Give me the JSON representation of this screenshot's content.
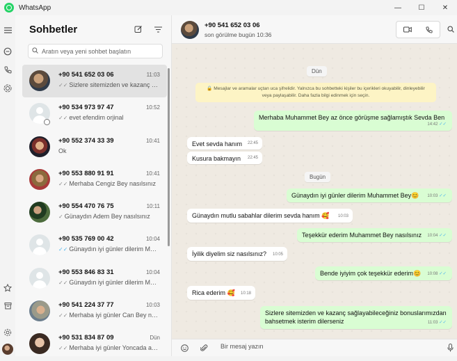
{
  "window": {
    "title": "WhatsApp",
    "controls": {
      "minimize": "—",
      "maximize": "☐",
      "close": "✕"
    }
  },
  "rail": {
    "icons": [
      "menu-icon",
      "chats-icon",
      "calls-icon",
      "status-icon",
      "starred-icon",
      "archive-icon",
      "settings-icon",
      "profile-avatar"
    ]
  },
  "sidebar": {
    "title": "Sohbetler",
    "new_chat_icon": "new-chat-icon",
    "filter_icon": "filter-icon",
    "search_placeholder": "Aratın veya yeni sohbet başlatın"
  },
  "chats": [
    {
      "name": "+90 541 652 03 06",
      "time": "11:03",
      "tick": "✓✓",
      "preview": "Sizlere sitemizden ve kazanç sağlayabileceğiniz bonuslarımızdan",
      "selected": true
    },
    {
      "name": "+90 534 973 97 47",
      "time": "10:52",
      "tick": "✓✓",
      "preview": "evet efendim orjinal"
    },
    {
      "name": "+90 552 374 33 39",
      "time": "10:41",
      "tick": "",
      "preview": "Ok"
    },
    {
      "name": "+90 553 880 91 91",
      "time": "10:41",
      "tick": "✓✓",
      "preview": "Merhaba Cengiz Bey nasılsınız"
    },
    {
      "name": "+90 554 470 76 75",
      "time": "10:11",
      "tick": "✓",
      "preview": "Günaydın Adem Bey nasılsınız"
    },
    {
      "name": "+90 535 769 00 42",
      "time": "10:04",
      "tick": "✓✓",
      "preview": "Günaydın iyi günler dilerim Muhammet Bey"
    },
    {
      "name": "+90 553 846 83 31",
      "time": "10:04",
      "tick": "✓✓",
      "preview": "Günaydın iyi günler dilerim Muhammet Bey"
    },
    {
      "name": "+90 541 224 37 77",
      "time": "10:03",
      "tick": "✓✓",
      "preview": "Merhaba iyi günler Can Bey nasılsınız"
    },
    {
      "name": "+90 531 834 87 09",
      "time": "Dün",
      "tick": "✓✓",
      "preview": "Merhaba iyi günler Yoncada ablam"
    }
  ],
  "conversation": {
    "name": "+90 541 652 03 06",
    "status": "son görülme bugün 10:36",
    "day_yesterday": "Dün",
    "day_today": "Bugün",
    "encryption_notice": "🔒 Mesajlar ve aramalar uçtan uca şifrelidir. Yalnızca bu sohbetteki kişiler bu içerikleri okuyabilir, dinleyebilir veya paylaşabilir. Daha fazla bilgi edinmek için seçin.",
    "messages": [
      {
        "dir": "out",
        "text": "Merhaba Muhammet Bey az önce görüşme sağlamıştık Sevda Ben",
        "time": "14:42",
        "tick": "✓✓"
      },
      {
        "dir": "in",
        "text": "Evet sevda hanım",
        "time": "22:45"
      },
      {
        "dir": "in",
        "text": "Kusura bakmayın",
        "time": "22:45"
      },
      {
        "dir": "out",
        "text": "Günaydın iyi günler dilerim Muhammet Bey😊",
        "time": "10:03",
        "tick": "✓✓"
      },
      {
        "dir": "in",
        "text": "Günaydın mutlu sabahlar dilerim sevda hanım 🥰",
        "time": "10:03"
      },
      {
        "dir": "out",
        "text": "Teşekkür ederim Muhammet Bey nasılsınız",
        "time": "10:04",
        "tick": "✓✓"
      },
      {
        "dir": "in",
        "text": "İyilik diyelim siz nasılsınız?",
        "time": "10:05"
      },
      {
        "dir": "out",
        "text": "Bende iyiyim çok teşekkür ederim😊",
        "time": "10:08",
        "tick": "✓✓"
      },
      {
        "dir": "in",
        "text": "Rica ederim 🥰",
        "time": "10:18"
      },
      {
        "dir": "out",
        "text": "Sizlere sitemizden ve kazanç sağlayabileceğiniz bonuslarımızdan bahsetmek isterim dilerseniz",
        "time": "11:03",
        "tick": "✓✓"
      }
    ]
  },
  "composer": {
    "placeholder": "Bir mesaj yazın"
  }
}
